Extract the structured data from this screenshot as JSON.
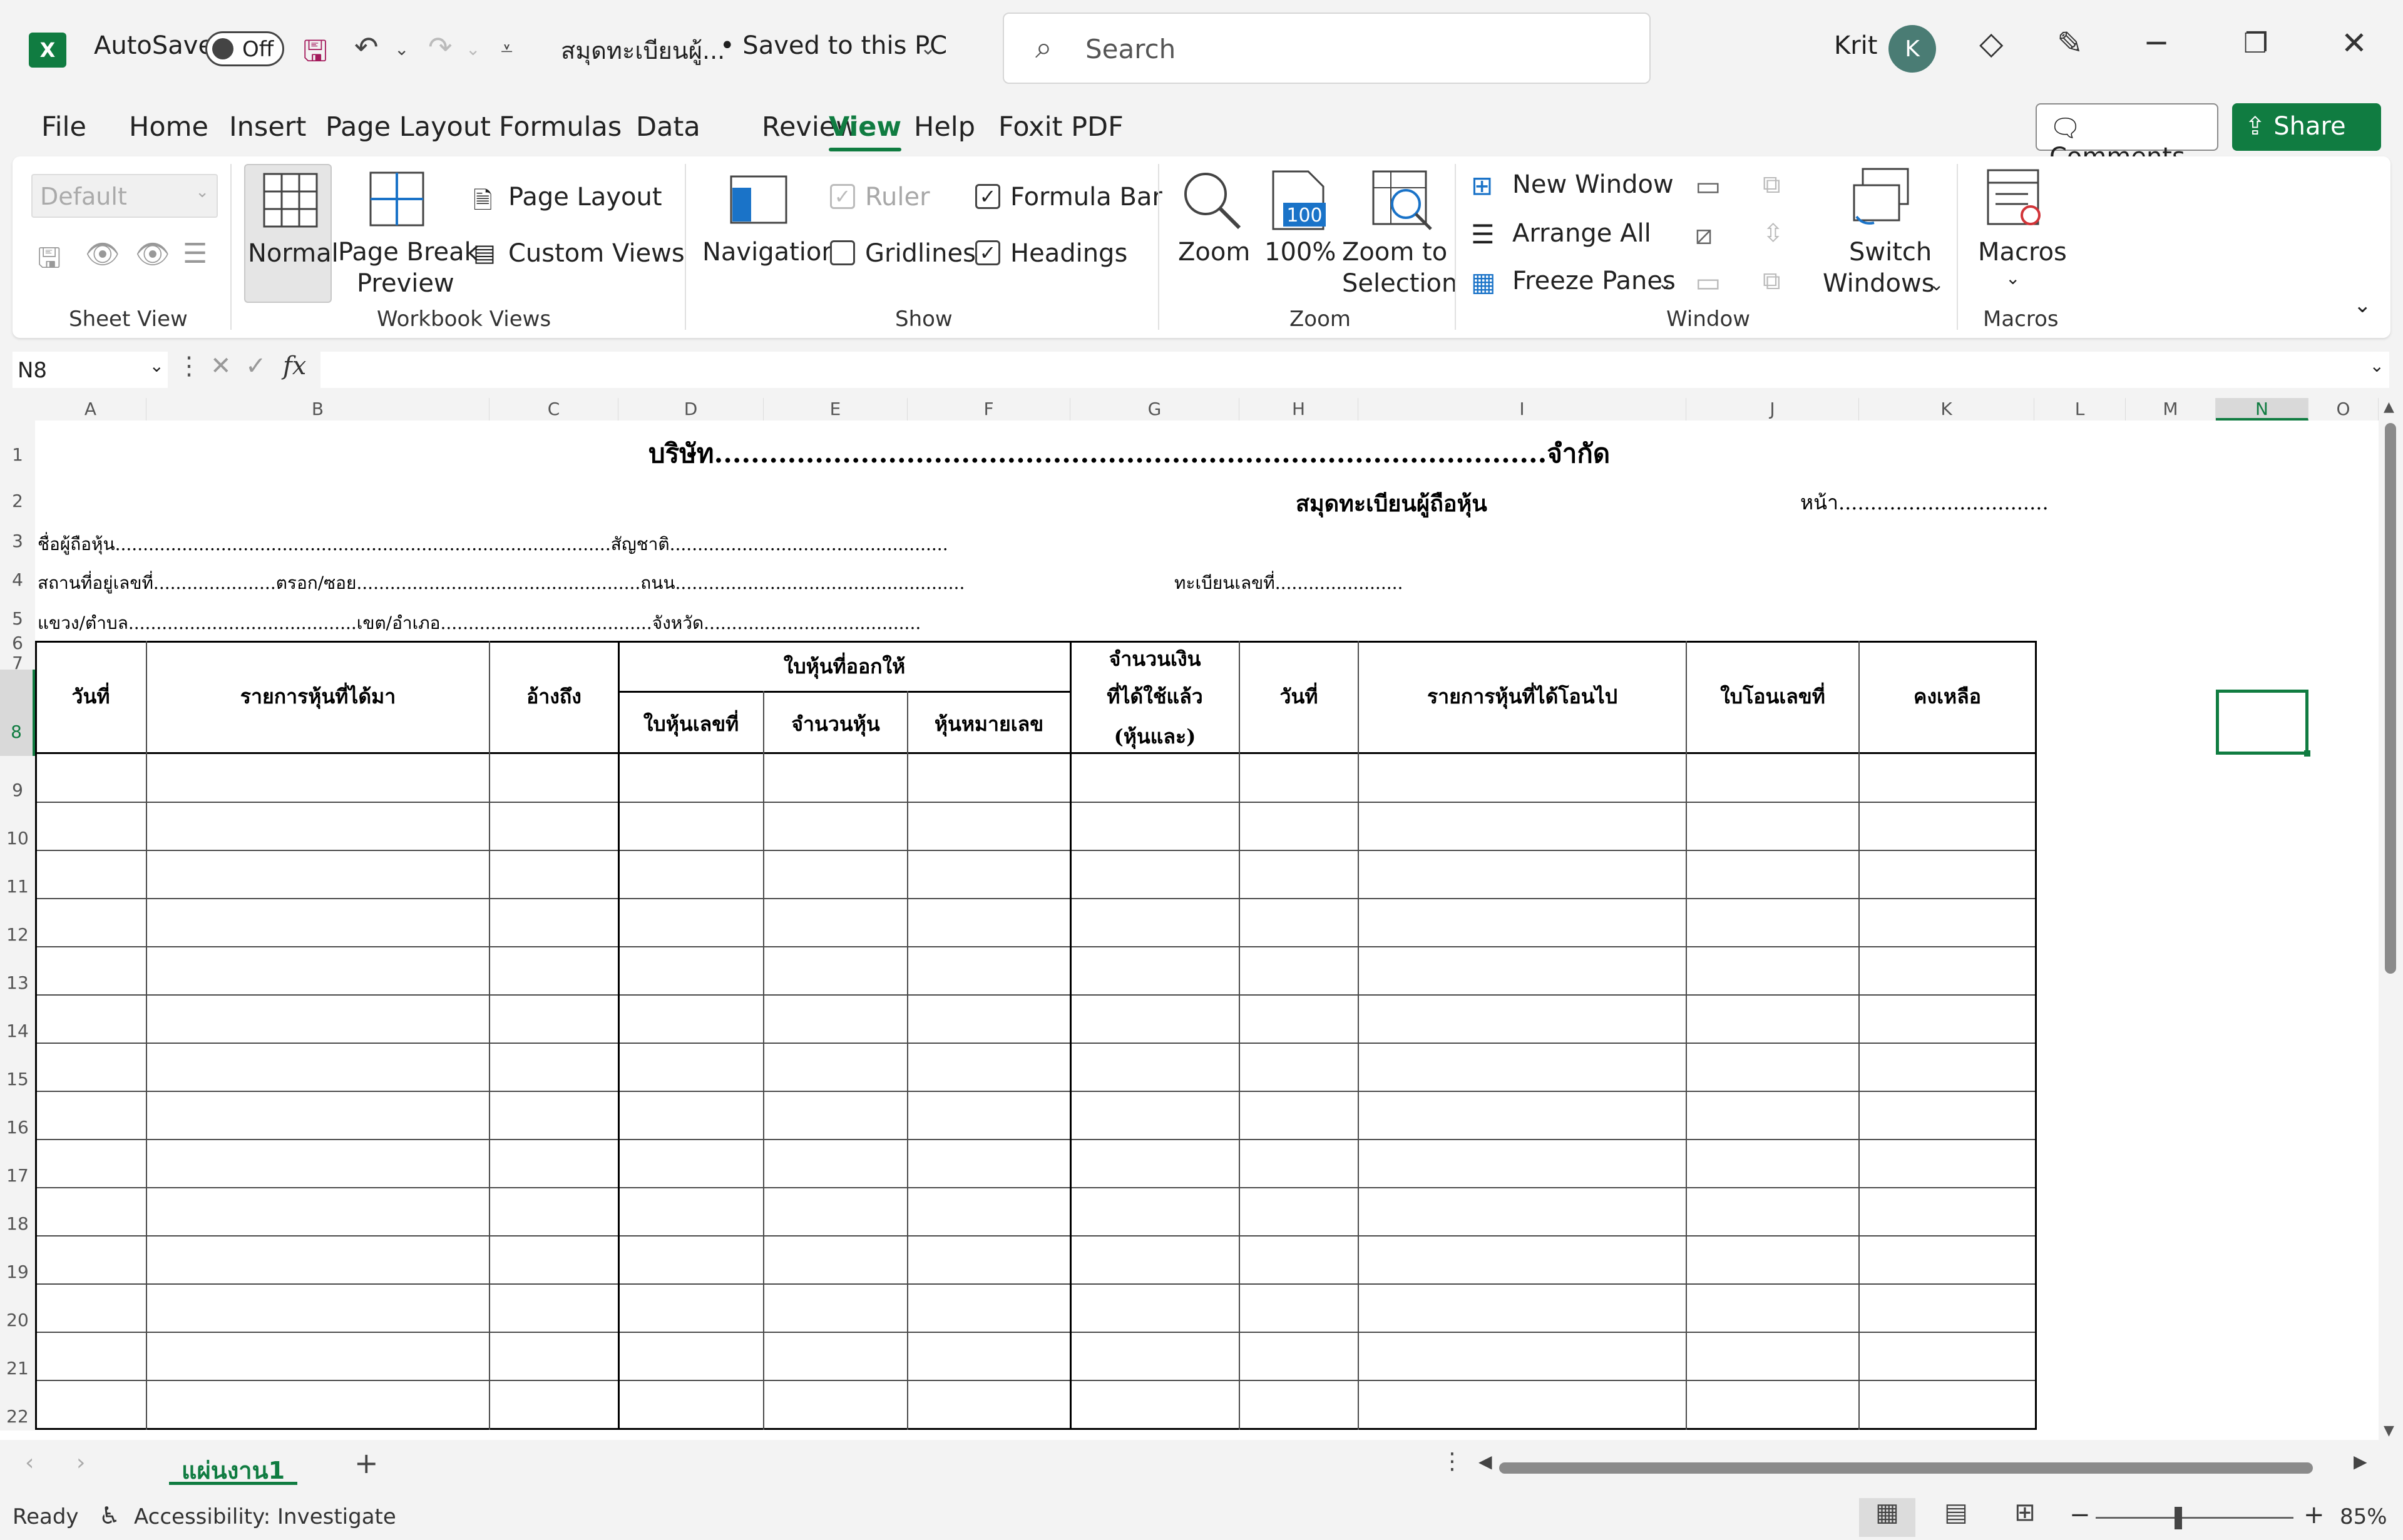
{
  "titlebar": {
    "app_icon": "X",
    "autosave_label": "AutoSave",
    "autosave_state": "Off",
    "filename": "สมุดทะเบียนผู้...",
    "save_status": "• Saved to this PC",
    "search_placeholder": "Search",
    "user_name": "Krit",
    "user_initial": "K"
  },
  "menu": {
    "tabs": [
      "File",
      "Home",
      "Insert",
      "Page Layout",
      "Formulas",
      "Data",
      "Review",
      "View",
      "Help",
      "Foxit PDF"
    ],
    "active": "View",
    "comments": "Comments",
    "share": "Share"
  },
  "ribbon": {
    "sheet_view": {
      "label": "Sheet View",
      "default_select": "Default"
    },
    "workbook_views": {
      "label": "Workbook Views",
      "normal": "Normal",
      "page_break_1": "Page Break",
      "page_break_2": "Preview",
      "page_layout": "Page Layout",
      "custom_views": "Custom Views"
    },
    "show": {
      "label": "Show",
      "navigation": "Navigation",
      "ruler": "Ruler",
      "formula_bar": "Formula Bar",
      "gridlines": "Gridlines",
      "headings": "Headings"
    },
    "zoom": {
      "label": "Zoom",
      "zoom": "Zoom",
      "hundred": "100%",
      "hundred_icon": "100",
      "zoom_sel_1": "Zoom to",
      "zoom_sel_2": "Selection"
    },
    "window": {
      "label": "Window",
      "new_window": "New Window",
      "arrange_all": "Arrange All",
      "freeze_panes": "Freeze Panes",
      "switch_1": "Switch",
      "switch_2": "Windows"
    },
    "macros": {
      "label": "Macros",
      "macros": "Macros"
    }
  },
  "formula_bar": {
    "name_box": "N8",
    "fx": "fx",
    "value": ""
  },
  "sheet": {
    "columns": [
      "A",
      "B",
      "C",
      "D",
      "E",
      "F",
      "G",
      "H",
      "I",
      "J",
      "K",
      "L",
      "M",
      "N",
      "O"
    ],
    "selected_column": "N",
    "rows": [
      "1",
      "2",
      "3",
      "4",
      "5",
      "6",
      "7",
      "8",
      "9",
      "10",
      "11",
      "12",
      "13",
      "14",
      "15",
      "16",
      "17",
      "18",
      "19",
      "20",
      "21",
      "22"
    ],
    "selected_row": "8",
    "title": "บริษัท...........................................................................................จำกัด",
    "subtitle": "สมุดทะเบียนผู้ถือหุ้น",
    "page": "หน้า.................................",
    "line3": "ชื่อผู้ถือหุ้น.........................................................................................สัญชาติ..................................................",
    "line4": "สถานที่อยู่เลขที่......................ตรอก/ซอย...................................................ถนน....................................................",
    "line4_reg": "ทะเบียนเลขที่.......................",
    "line5": "แขวง/ตำบล.........................................เขต/อำเภอ......................................จังหวัด.......................................",
    "headers": {
      "date": "วันที่",
      "received": "รายการหุ้นที่ได้มา",
      "ref": "อ้างถึง",
      "issued": "ใบหุ้นที่ออกให้",
      "cert_no": "ใบหุ้นเลขที่",
      "shares": "จำนวนหุ้น",
      "share_no": "หุ้นหมายเลข",
      "paid_1": "จำนวนเงิน",
      "paid_2": "ที่ได้ใช้แล้ว",
      "paid_3": "(หุ้นและ)",
      "date2": "วันที่",
      "transferred": "รายการหุ้นที่ได้โอนไป",
      "transfer_no": "ใบโอนเลขที่",
      "remaining": "คงเหลือ"
    }
  },
  "tabs": {
    "sheet_name": "แผ่นงาน1",
    "add": "+"
  },
  "status": {
    "ready": "Ready",
    "accessibility": "Accessibility: Investigate",
    "zoom": "85%"
  },
  "colors": {
    "accent": "#107c41"
  }
}
